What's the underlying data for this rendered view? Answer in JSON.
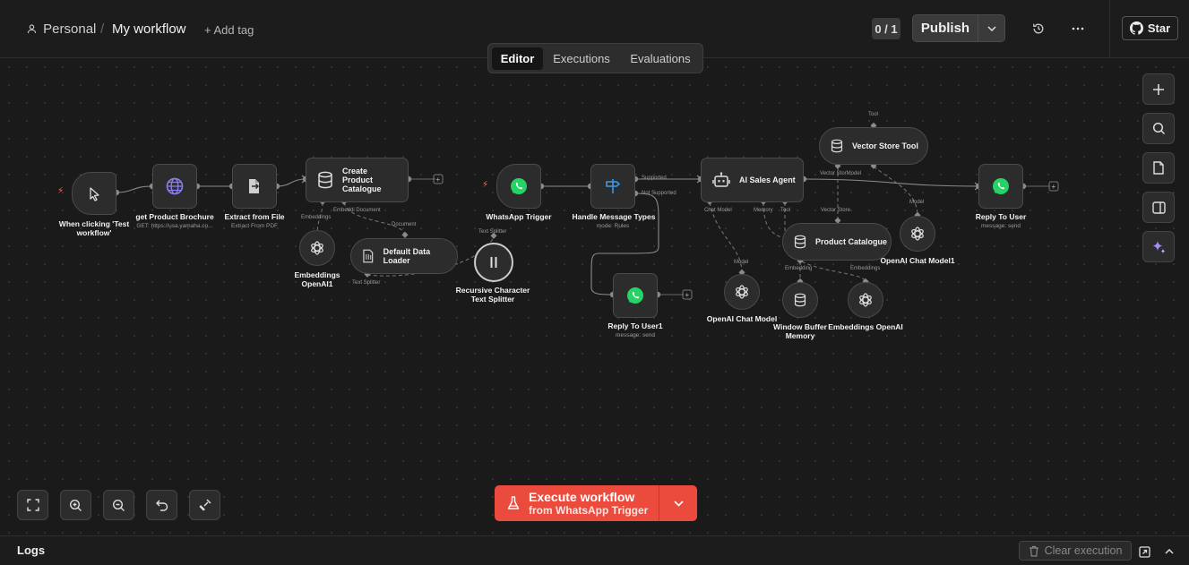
{
  "header": {
    "project": "Personal",
    "workflow_name": "My workflow",
    "add_tag": "+ Add tag",
    "counter": "0 / 1",
    "publish": "Publish",
    "star": "Star"
  },
  "tabs": [
    {
      "label": "Editor",
      "active": true
    },
    {
      "label": "Executions",
      "active": false
    },
    {
      "label": "Evaluations",
      "active": false
    }
  ],
  "nodes": {
    "manual_trigger": {
      "label": "When clicking 'Test workflow'"
    },
    "get_brochure": {
      "label": "get Product Brochure",
      "sub": "GET: https://usa.yamaha.co..."
    },
    "extract_file": {
      "label": "Extract from File",
      "sub": "Extract From PDF"
    },
    "create_catalogue": {
      "label": "Create Product Catalogue"
    },
    "embeddings_openai1": {
      "label": "Embeddings OpenAI1"
    },
    "default_loader": {
      "label": "Default Data Loader"
    },
    "text_splitter": {
      "label": "Recursive Character Text Splitter"
    },
    "whatsapp_trigger": {
      "label": "WhatsApp Trigger"
    },
    "handle_types": {
      "label": "Handle Message Types",
      "sub": "mode: Rules"
    },
    "reply_user1": {
      "label": "Reply To User1",
      "sub": "message: send"
    },
    "ai_agent": {
      "label": "AI Sales Agent"
    },
    "vector_tool": {
      "label": "Vector Store Tool"
    },
    "product_catalogue": {
      "label": "Product Catalogue"
    },
    "openai_chat": {
      "label": "OpenAI Chat Model"
    },
    "window_memory": {
      "label": "Window Buffer Memory"
    },
    "embeddings_openai": {
      "label": "Embeddings OpenAI"
    },
    "openai_chat1": {
      "label": "OpenAI Chat Model1"
    },
    "reply_user": {
      "label": "Reply To User",
      "sub": "message: send"
    }
  },
  "ports": {
    "embeddings": "Embeddings",
    "document": "Document",
    "embeddi_document": "Embeddi Document",
    "text_splitter": "Text Splitter",
    "text_splitter2": "Text Splitter",
    "supported": "Supported",
    "not_supported": "Not Supported",
    "chat_model": "Chat Model",
    "memory": "Memory",
    "tool": "Tool",
    "tool_top": "Tool",
    "vector_store": "Vector Store",
    "vector_store_model": "Vector StorModel",
    "model_a": "Model",
    "model_b": "Model",
    "embedding_pc": "Embedding",
    "embeddings_pc": "Embeddings"
  },
  "execute": {
    "title": "Execute workflow",
    "subtitle": "from WhatsApp Trigger"
  },
  "footer": {
    "logs": "Logs",
    "clear": "Clear execution"
  },
  "colors": {
    "accent": "#ea4b3c",
    "whatsapp": "#25d366",
    "trigger_bolt": "#ff6d5a",
    "http": "#7b6ff2",
    "switch": "#3b9be8"
  }
}
